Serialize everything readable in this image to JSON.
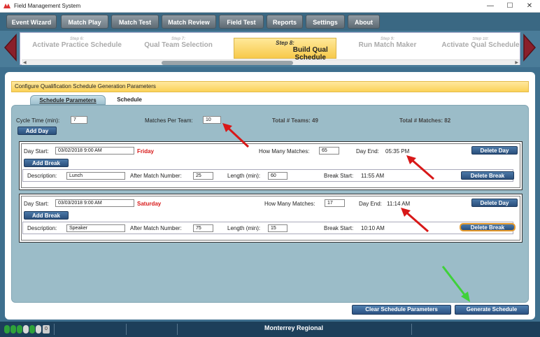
{
  "window": {
    "title": "Field Management System",
    "controls": [
      "—",
      "☐",
      "✕"
    ]
  },
  "menu": [
    {
      "label": "Event Wizard"
    },
    {
      "label": "Match Play"
    },
    {
      "label": "Match Test"
    },
    {
      "label": "Match Review"
    },
    {
      "label": "Field Test"
    },
    {
      "label": "Reports"
    },
    {
      "label": "Settings"
    },
    {
      "label": "About"
    }
  ],
  "wizard": {
    "steps": [
      {
        "num": "Step 6:",
        "label": "Activate Practice Schedule"
      },
      {
        "num": "Step 7:",
        "label": "Qual Team Selection"
      },
      {
        "num": "Step 8:",
        "label": "Build Qual Schedule"
      },
      {
        "num": "Step 9:",
        "label": "Run Match Maker"
      },
      {
        "num": "Step 10:",
        "label": "Activate Qual Schedule"
      }
    ]
  },
  "panel": {
    "header": "Configure Qualification Schedule Generation Parameters",
    "tabs": [
      "Schedule Parameters",
      "Schedule"
    ]
  },
  "params": {
    "cycle_time_label": "Cycle Time (min):",
    "cycle_time_value": "7",
    "matches_per_team_label": "Matches Per Team:",
    "matches_per_team_value": "10",
    "total_teams": "Total # Teams: 49",
    "total_matches": "Total # Matches: 82",
    "add_day_label": "Add Day"
  },
  "days": [
    {
      "start_label": "Day Start:",
      "start_value": "03/02/2018 9:00 AM",
      "weekday": "Friday",
      "how_many_label": "How Many Matches:",
      "how_many_value": "65",
      "day_end_label": "Day End:",
      "day_end_value": "05:35 PM",
      "delete_day": "Delete Day",
      "add_break": "Add Break",
      "break": {
        "desc_label": "Description:",
        "desc_value": "Lunch",
        "after_label": "After Match Number:",
        "after_value": "25",
        "length_label": "Length (min):",
        "length_value": "60",
        "start_label": "Break Start:",
        "start_value": "11:55 AM",
        "delete_break": "Delete Break"
      }
    },
    {
      "start_label": "Day Start:",
      "start_value": "03/03/2018 9:00 AM",
      "weekday": "Saturday",
      "how_many_label": "How Many Matches:",
      "how_many_value": "17",
      "day_end_label": "Day End:",
      "day_end_value": "11:14 AM",
      "delete_day": "Delete Day",
      "add_break": "Add Break",
      "break": {
        "desc_label": "Description:",
        "desc_value": "Speaker",
        "after_label": "After Match Number:",
        "after_value": "75",
        "length_label": "Length (min):",
        "length_value": "15",
        "start_label": "Break Start:",
        "start_value": "10:10 AM",
        "delete_break": "Delete Break"
      }
    }
  ],
  "actions": {
    "clear": "Clear Schedule Parameters",
    "generate": "Generate Schedule"
  },
  "status": {
    "event_name": "Monterrey Regional",
    "counter": "0"
  },
  "colors": {
    "accent_yellow": "#fbd257",
    "annotation_red": "#d81818",
    "annotation_green": "#3fd13a",
    "weekday_red": "#d81818"
  }
}
